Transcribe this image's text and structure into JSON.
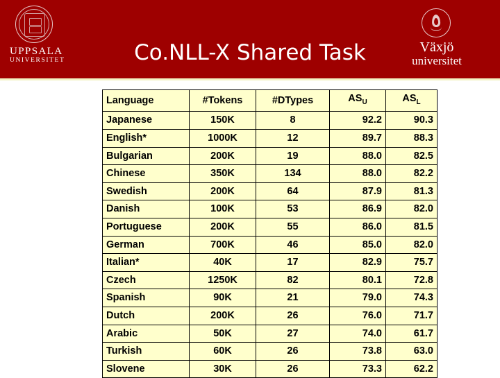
{
  "header": {
    "title": "Co.NLL-X Shared Task",
    "background_color": "#9E0000",
    "underline_color": "#F2F2C4",
    "logo_left": {
      "name": "UPPSALA",
      "subtitle": "UNIVERSITET",
      "icon": "uppsala-seal-icon"
    },
    "logo_right": {
      "name": "Växjö",
      "subtitle": "universitet",
      "icon": "vaxjo-flame-icon"
    }
  },
  "table": {
    "background_color": "#FFFFCC",
    "columns": [
      {
        "key": "language",
        "label": "Language"
      },
      {
        "key": "tokens",
        "label": "#Tokens"
      },
      {
        "key": "dtypes",
        "label": "#DTypes"
      },
      {
        "key": "asu",
        "label": "AS",
        "sub": "U"
      },
      {
        "key": "asl",
        "label": "AS",
        "sub": "L"
      }
    ],
    "rows": [
      {
        "language": "Japanese",
        "tokens": "150K",
        "dtypes": "8",
        "asu": "92.2",
        "asl": "90.3"
      },
      {
        "language": "English*",
        "tokens": "1000K",
        "dtypes": "12",
        "asu": "89.7",
        "asl": "88.3"
      },
      {
        "language": "Bulgarian",
        "tokens": "200K",
        "dtypes": "19",
        "asu": "88.0",
        "asl": "82.5"
      },
      {
        "language": "Chinese",
        "tokens": "350K",
        "dtypes": "134",
        "asu": "88.0",
        "asl": "82.2"
      },
      {
        "language": "Swedish",
        "tokens": "200K",
        "dtypes": "64",
        "asu": "87.9",
        "asl": "81.3"
      },
      {
        "language": "Danish",
        "tokens": "100K",
        "dtypes": "53",
        "asu": "86.9",
        "asl": "82.0"
      },
      {
        "language": "Portuguese",
        "tokens": "200K",
        "dtypes": "55",
        "asu": "86.0",
        "asl": "81.5"
      },
      {
        "language": "German",
        "tokens": "700K",
        "dtypes": "46",
        "asu": "85.0",
        "asl": "82.0"
      },
      {
        "language": "Italian*",
        "tokens": "40K",
        "dtypes": "17",
        "asu": "82.9",
        "asl": "75.7"
      },
      {
        "language": "Czech",
        "tokens": "1250K",
        "dtypes": "82",
        "asu": "80.1",
        "asl": "72.8"
      },
      {
        "language": "Spanish",
        "tokens": "90K",
        "dtypes": "21",
        "asu": "79.0",
        "asl": "74.3"
      },
      {
        "language": "Dutch",
        "tokens": "200K",
        "dtypes": "26",
        "asu": "76.0",
        "asl": "71.7"
      },
      {
        "language": "Arabic",
        "tokens": "50K",
        "dtypes": "27",
        "asu": "74.0",
        "asl": "61.7"
      },
      {
        "language": "Turkish",
        "tokens": "60K",
        "dtypes": "26",
        "asu": "73.8",
        "asl": "63.0"
      },
      {
        "language": "Slovene",
        "tokens": "30K",
        "dtypes": "26",
        "asu": "73.3",
        "asl": "62.2"
      }
    ]
  }
}
